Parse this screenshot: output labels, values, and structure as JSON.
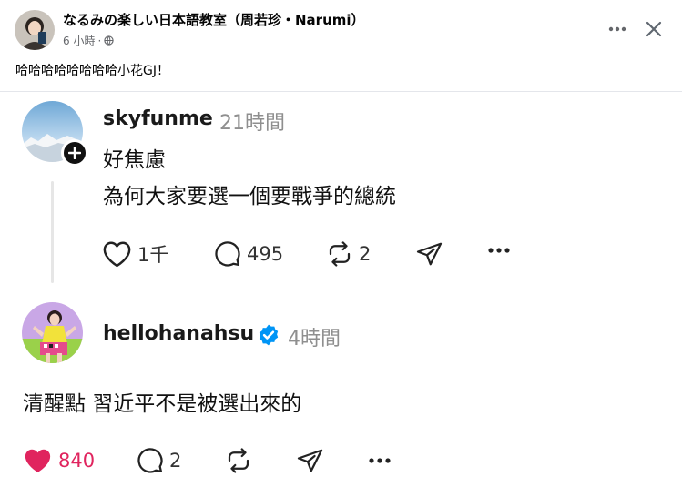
{
  "post": {
    "author": "なるみの楽しい日本語教室（周若珍・Narumi）",
    "time": "6 小時",
    "separator": "·",
    "caption": "哈哈哈哈哈哈哈哈小花GJ！"
  },
  "threads": [
    {
      "username": "skyfunme",
      "time": "21時間",
      "lines": [
        "好焦慮",
        "為何大家要選一個要戰爭的總統"
      ],
      "likes": "1千",
      "replies": "495",
      "reposts": "2"
    },
    {
      "username": "hellohanahsu",
      "verified": true,
      "time": "4時間",
      "lines": [
        "清醒點 習近平不是被選出來的"
      ],
      "likes": "840",
      "replies": "2",
      "liked": true
    }
  ],
  "colors": {
    "like_red": "#e0245e",
    "verified_blue": "#0095f6",
    "meta_gray": "#65676b"
  },
  "icons": [
    "globe-icon",
    "more-icon",
    "close-icon",
    "plus-icon",
    "heart-icon",
    "comment-icon",
    "repost-icon",
    "share-icon",
    "verified-icon"
  ]
}
